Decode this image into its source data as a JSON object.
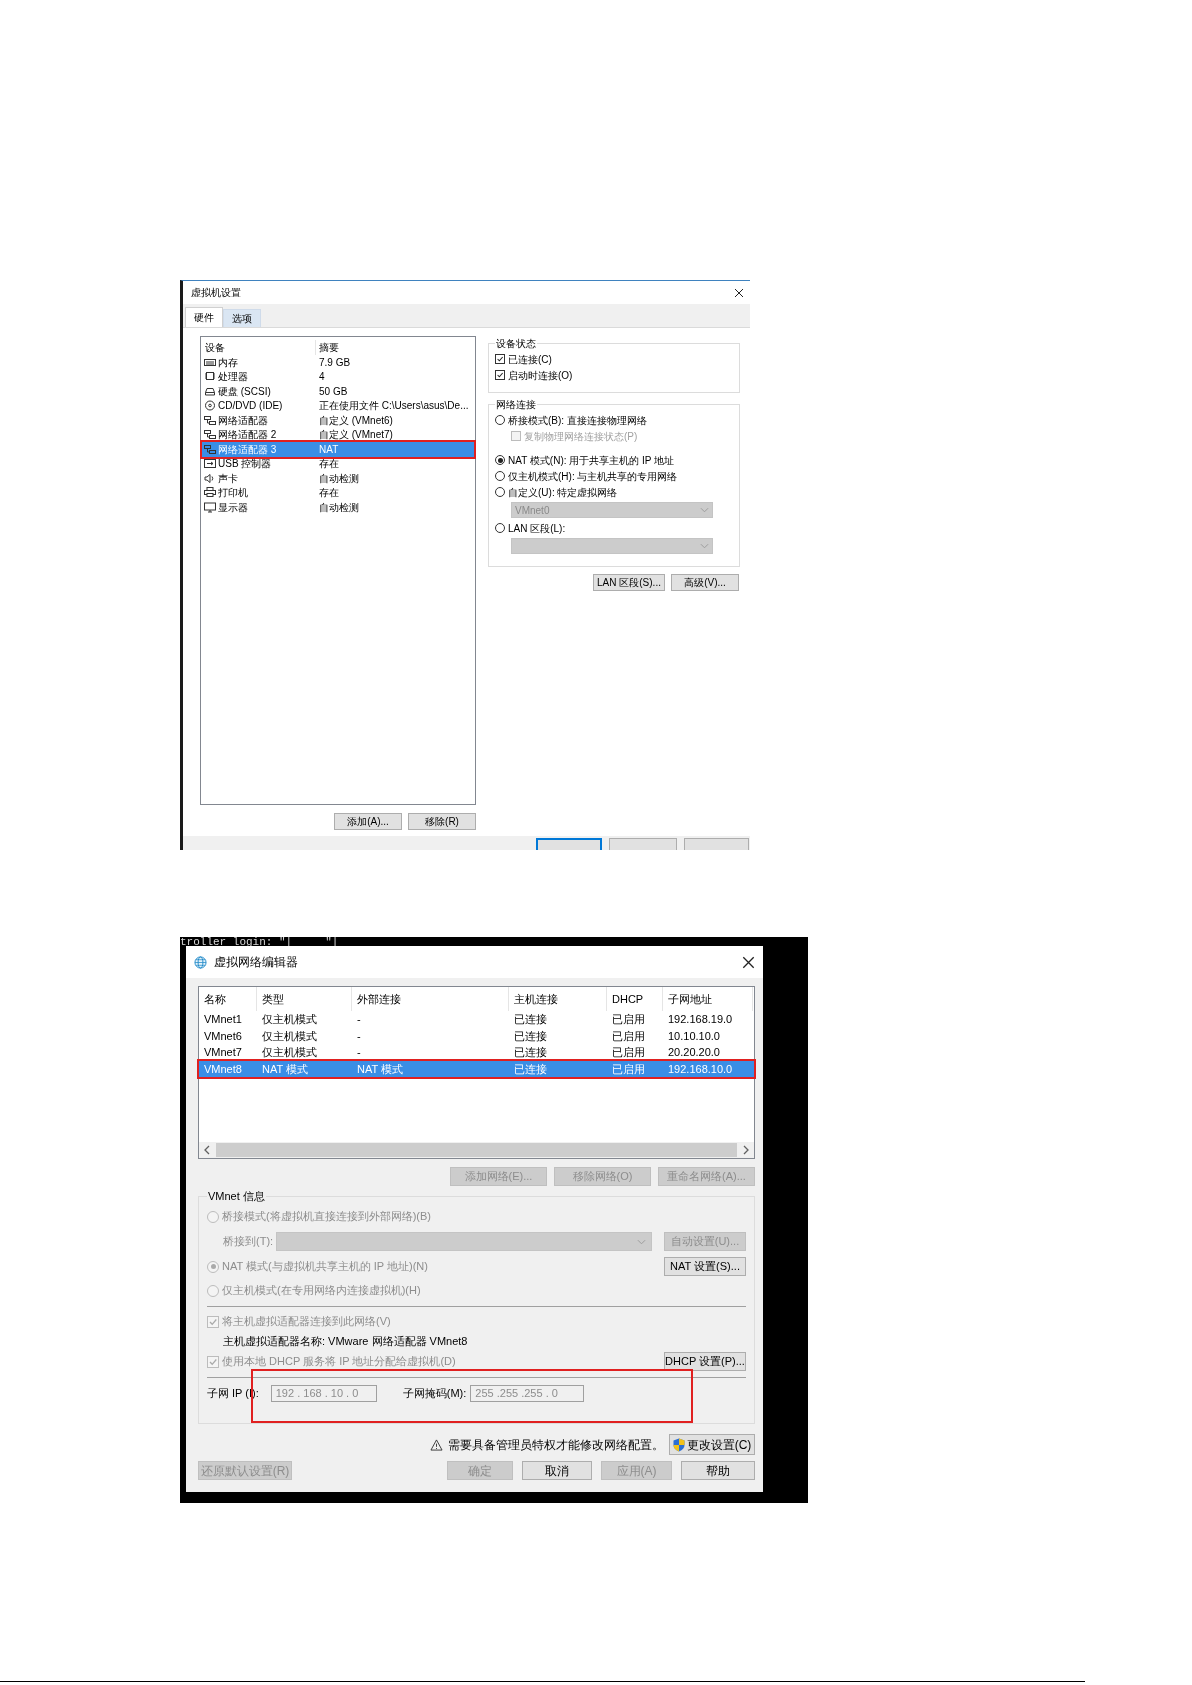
{
  "dialog_1": {
    "title": "虚拟机设置",
    "tabs": [
      {
        "label": "硬件",
        "selected": true
      },
      {
        "label": "选项",
        "selected": false
      }
    ],
    "devices": {
      "columns": [
        "设备",
        "摘要"
      ],
      "rows": [
        {
          "kind": "memory",
          "device": "内存",
          "summary": "7.9 GB",
          "selected": false,
          "annotated": false
        },
        {
          "kind": "processor",
          "device": "处理器",
          "summary": "4",
          "selected": false,
          "annotated": false
        },
        {
          "kind": "disk",
          "device": "硬盘 (SCSI)",
          "summary": "50 GB",
          "selected": false,
          "annotated": false
        },
        {
          "kind": "cd",
          "device": "CD/DVD (IDE)",
          "summary": "正在使用文件 C:\\Users\\asus\\De...",
          "selected": false,
          "annotated": false
        },
        {
          "kind": "network",
          "device": "网络适配器",
          "summary": "自定义 (VMnet6)",
          "selected": false,
          "annotated": false
        },
        {
          "kind": "network",
          "device": "网络适配器 2",
          "summary": "自定义 (VMnet7)",
          "selected": false,
          "annotated": false
        },
        {
          "kind": "network",
          "device": "网络适配器 3",
          "summary": "NAT",
          "selected": true,
          "annotated": true
        },
        {
          "kind": "usb",
          "device": "USB 控制器",
          "summary": "存在",
          "selected": false,
          "annotated": false
        },
        {
          "kind": "sound",
          "device": "声卡",
          "summary": "自动检测",
          "selected": false,
          "annotated": false
        },
        {
          "kind": "printer",
          "device": "打印机",
          "summary": "存在",
          "selected": false,
          "annotated": false
        },
        {
          "kind": "display",
          "device": "显示器",
          "summary": "自动检测",
          "selected": false,
          "annotated": false
        }
      ]
    },
    "list_buttons": [
      {
        "label": "添加(A)..."
      },
      {
        "label": "移除(R)"
      }
    ],
    "device_status": {
      "title": "设备状态",
      "options": [
        {
          "label": "已连接(C)",
          "checked": true
        },
        {
          "label": "启动时连接(O)",
          "checked": true
        }
      ]
    },
    "network_connection": {
      "title": "网络连接",
      "items": [
        {
          "kind": "radio",
          "label": "桥接模式(B): 直接连接物理网络",
          "selected": false
        },
        {
          "kind": "checkbox",
          "label": "复制物理网络连接状态(P)",
          "checked": false,
          "disabled": true
        },
        {
          "kind": "radio",
          "label": "NAT 模式(N): 用于共享主机的 IP 地址",
          "selected": true
        },
        {
          "kind": "radio",
          "label": "仅主机模式(H): 与主机共享的专用网络",
          "selected": false
        },
        {
          "kind": "radio",
          "label": "自定义(U): 特定虚拟网络",
          "selected": false
        },
        {
          "kind": "select",
          "value": "VMnet0",
          "disabled": true
        },
        {
          "kind": "radio",
          "label": "LAN 区段(L):",
          "selected": false
        },
        {
          "kind": "select",
          "disabled": true
        }
      ]
    },
    "buttons": [
      {
        "label": "LAN 区段(S)..."
      },
      {
        "label": "高级(V)..."
      }
    ]
  },
  "dialog_2": {
    "terminal_text": "troller login: \"|     \"|",
    "title": "虚拟网络编辑器",
    "networks": {
      "columns": [
        "名称",
        "类型",
        "外部连接",
        "主机连接",
        "DHCP",
        "子网地址"
      ],
      "rows": [
        {
          "cells": [
            "VMnet1",
            "仅主机模式",
            "-",
            "已连接",
            "已启用",
            "192.168.19.0"
          ],
          "selected": false,
          "annotated": false
        },
        {
          "cells": [
            "VMnet6",
            "仅主机模式",
            "-",
            "已连接",
            "已启用",
            "10.10.10.0"
          ],
          "selected": false,
          "annotated": false
        },
        {
          "cells": [
            "VMnet7",
            "仅主机模式",
            "-",
            "已连接",
            "已启用",
            "20.20.20.0"
          ],
          "selected": false,
          "annotated": false
        },
        {
          "cells": [
            "VMnet8",
            "NAT 模式",
            "NAT 模式",
            "已连接",
            "已启用",
            "192.168.10.0"
          ],
          "selected": true,
          "annotated": true
        }
      ]
    },
    "network_buttons": [
      {
        "label": "添加网络(E)...",
        "disabled": true
      },
      {
        "label": "移除网络(O)",
        "disabled": true
      },
      {
        "label": "重命名网络(A)...",
        "disabled": true
      }
    ],
    "vmnet_info": {
      "title": "VMnet 信息",
      "bridged": {
        "label": "桥接模式(将虚拟机直接连接到外部网络)(B)",
        "selected": false,
        "disabled": true
      },
      "bridge_to": {
        "label": "桥接到(T):",
        "button": {
          "label": "自动设置(U)...",
          "disabled": true
        }
      },
      "nat": {
        "label": "NAT 模式(与虚拟机共享主机的 IP 地址)(N)",
        "selected": true,
        "disabled": true,
        "button": {
          "label": "NAT 设置(S)...",
          "disabled": false
        }
      },
      "host_only": {
        "label": "仅主机模式(在专用网络内连接虚拟机)(H)",
        "selected": false,
        "disabled": true
      },
      "connect_adapter": {
        "label": "将主机虚拟适配器连接到此网络(V)",
        "checked": true,
        "disabled": true
      },
      "adapter_name": "主机虚拟适配器名称: VMware 网络适配器 VMnet8",
      "use_dhcp": {
        "label": "使用本地 DHCP 服务将 IP 地址分配给虚拟机(D)",
        "checked": true,
        "disabled": true,
        "button": {
          "label": "DHCP 设置(P)...",
          "disabled": false
        }
      },
      "subnet": {
        "ip_label": "子网 IP (I):",
        "ip": "192 . 168 . 10 . 0",
        "mask_label": "子网掩码(M):",
        "mask": "255 .255 .255 . 0",
        "annotated": true
      }
    },
    "warning": "需要具备管理员特权才能修改网络配置。",
    "change_button": {
      "label": "更改设置(C)"
    },
    "bottom_buttons": [
      {
        "label": "还原默认设置(R)",
        "disabled": true
      },
      {
        "label": "确定",
        "disabled": true
      },
      {
        "label": "取消",
        "disabled": false
      },
      {
        "label": "应用(A)",
        "disabled": true
      },
      {
        "label": "帮助",
        "disabled": false
      }
    ]
  }
}
